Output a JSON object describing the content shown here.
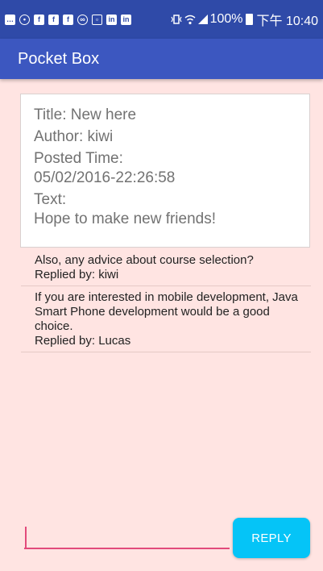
{
  "status_bar": {
    "battery_text": "100%",
    "time": "下午 10:40",
    "icons": [
      "chat-icon",
      "person-icon",
      "facebook-icon",
      "facebook-icon",
      "facebook-icon",
      "link-icon",
      "image-icon",
      "linkedin-icon",
      "linkedin-icon",
      "vibrate-icon",
      "wifi-icon",
      "signal-icon",
      "battery-icon"
    ]
  },
  "app_bar": {
    "title": "Pocket Box"
  },
  "post": {
    "title": "Title: New here",
    "author": "Author: kiwi",
    "posted_label": "Posted Time:",
    "posted_value": "05/02/2016-22:26:58",
    "text_label": "Text:",
    "text_value": "Hope to make new friends!"
  },
  "replies": [
    {
      "text": "Also, any advice about course selection?",
      "replied_by": "Replied by: kiwi"
    },
    {
      "text": "If you are interested in mobile development, Java Smart Phone development would be a good choice.",
      "replied_by": "Replied by: Lucas"
    }
  ],
  "compose": {
    "input_value": "",
    "button_label": "REPLY"
  },
  "colors": {
    "status_bar": "#2f4aa8",
    "app_bar": "#3c57c0",
    "background": "#ffe4e2",
    "accent": "#e24a7b",
    "button": "#05c4f7"
  }
}
